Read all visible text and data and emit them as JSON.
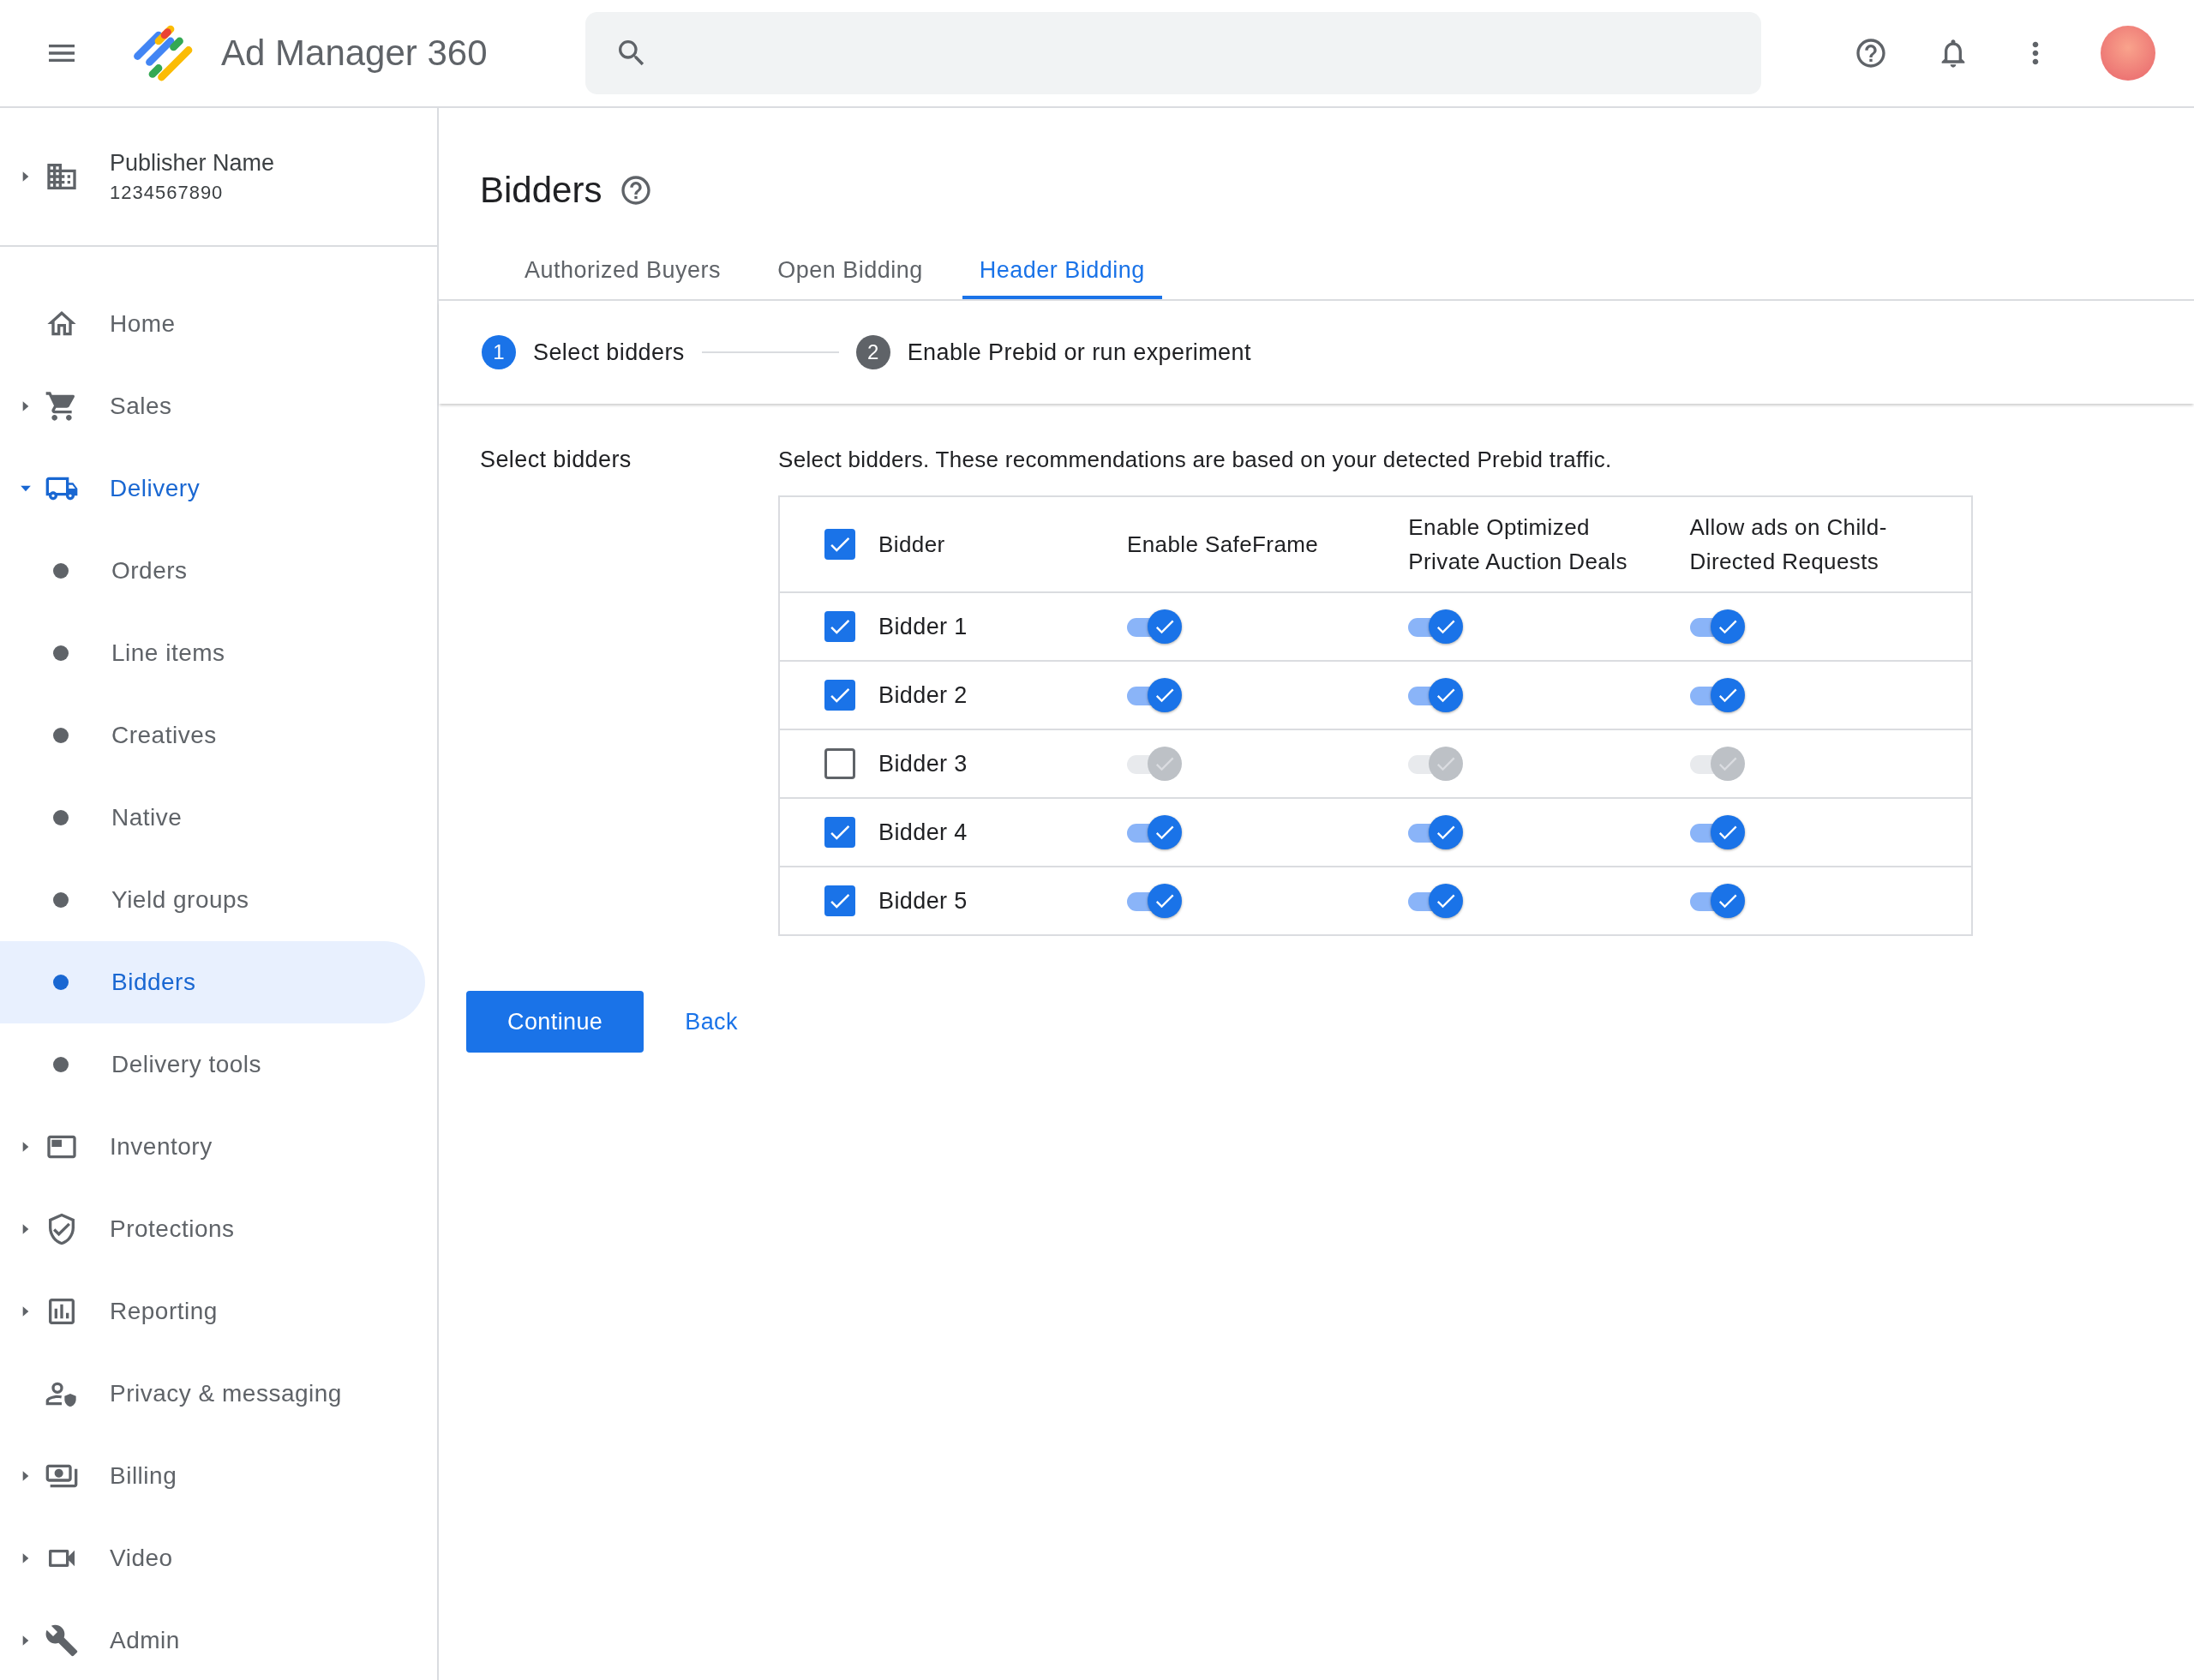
{
  "app_bar": {
    "title": "Ad Manager 360"
  },
  "publisher": {
    "name": "Publisher Name",
    "id": "1234567890"
  },
  "nav": [
    {
      "label": "Home",
      "kind": "link",
      "selected": false
    },
    {
      "label": "Sales",
      "kind": "group",
      "expanded": false,
      "selected": false
    },
    {
      "label": "Delivery",
      "kind": "group",
      "expanded": true,
      "selected": true,
      "children": [
        {
          "label": "Orders",
          "selected": false
        },
        {
          "label": "Line items",
          "selected": false
        },
        {
          "label": "Creatives",
          "selected": false
        },
        {
          "label": "Native",
          "selected": false
        },
        {
          "label": "Yield groups",
          "selected": false
        },
        {
          "label": "Bidders",
          "selected": true
        },
        {
          "label": "Delivery tools",
          "selected": false
        }
      ]
    },
    {
      "label": "Inventory",
      "kind": "group",
      "expanded": false,
      "selected": false
    },
    {
      "label": "Protections",
      "kind": "group",
      "expanded": false,
      "selected": false
    },
    {
      "label": "Reporting",
      "kind": "group",
      "expanded": false,
      "selected": false
    },
    {
      "label": "Privacy & messaging",
      "kind": "link",
      "selected": false
    },
    {
      "label": "Billing",
      "kind": "group",
      "expanded": false,
      "selected": false
    },
    {
      "label": "Video",
      "kind": "group",
      "expanded": false,
      "selected": false
    },
    {
      "label": "Admin",
      "kind": "group",
      "expanded": false,
      "selected": false
    }
  ],
  "page": {
    "title": "Bidders"
  },
  "tabs": [
    {
      "label": "Authorized Buyers",
      "selected": false
    },
    {
      "label": "Open Bidding",
      "selected": false
    },
    {
      "label": "Header Bidding",
      "selected": true
    }
  ],
  "steps": [
    {
      "number": "1",
      "label": "Select bidders",
      "active": true
    },
    {
      "number": "2",
      "label": "Enable Prebid or run experiment",
      "active": false
    }
  ],
  "section": {
    "label": "Select bidders",
    "description": "Select bidders. These recommendations are based on your detected Prebid traffic."
  },
  "table": {
    "all_checked": true,
    "columns": [
      "Bidder",
      "Enable SafeFrame",
      "Enable Optimized Private Auction Deals",
      "Allow ads on Child-Directed Requests"
    ],
    "rows": [
      {
        "name": "Bidder 1",
        "checked": true,
        "toggles": [
          {
            "on": true,
            "disabled": false
          },
          {
            "on": true,
            "disabled": false
          },
          {
            "on": true,
            "disabled": false
          }
        ]
      },
      {
        "name": "Bidder 2",
        "checked": true,
        "toggles": [
          {
            "on": true,
            "disabled": false
          },
          {
            "on": true,
            "disabled": false
          },
          {
            "on": true,
            "disabled": false
          }
        ]
      },
      {
        "name": "Bidder 3",
        "checked": false,
        "toggles": [
          {
            "on": true,
            "disabled": true
          },
          {
            "on": true,
            "disabled": true
          },
          {
            "on": true,
            "disabled": true
          }
        ]
      },
      {
        "name": "Bidder 4",
        "checked": true,
        "toggles": [
          {
            "on": true,
            "disabled": false
          },
          {
            "on": true,
            "disabled": false
          },
          {
            "on": true,
            "disabled": false
          }
        ]
      },
      {
        "name": "Bidder 5",
        "checked": true,
        "toggles": [
          {
            "on": true,
            "disabled": false
          },
          {
            "on": true,
            "disabled": false
          },
          {
            "on": true,
            "disabled": false
          }
        ]
      }
    ]
  },
  "buttons": {
    "primary": "Continue",
    "secondary": "Back"
  }
}
